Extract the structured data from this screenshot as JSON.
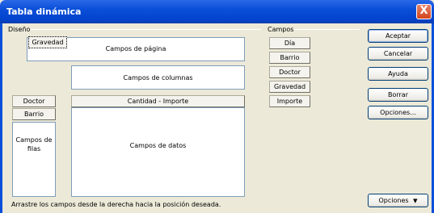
{
  "window": {
    "title": "Tabla dinámica",
    "close_glyph": "X"
  },
  "layout": {
    "group_label": "Diseño",
    "page_field_button": "Gravedad",
    "page_area_label": "Campos de página",
    "column_area_label": "Campos de columnas",
    "row_buttons": [
      "Doctor",
      "Barrio"
    ],
    "data_field_button": "Cantidad - Importe",
    "row_area_label_line1": "Campos de",
    "row_area_label_line2": "filas",
    "data_area_label": "Campos de datos",
    "hint": "Arrastre los campos desde la derecha hacia la posición deseada."
  },
  "fields": {
    "group_label": "Campos",
    "items": [
      "Día",
      "Barrio",
      "Doctor",
      "Gravedad",
      "Importe"
    ]
  },
  "actions": {
    "accept": "Aceptar",
    "cancel": "Cancelar",
    "help": "Ayuda",
    "delete": "Borrar",
    "options": "Opciones...",
    "options_more": "Opciones",
    "more_glyph": "▼"
  },
  "colors": {
    "title_bar": "#0a4fd8",
    "dialog_bg": "#ece9d8",
    "close": "#d2451c"
  }
}
